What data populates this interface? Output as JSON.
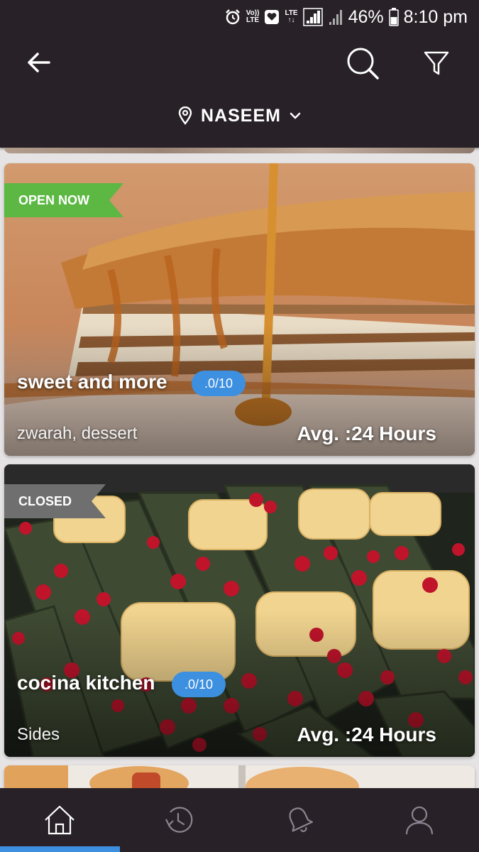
{
  "status_bar": {
    "volte_top": "Vo))",
    "volte_bottom": "LTE",
    "lte_label": "LTE",
    "battery": "46%",
    "time": "8:10 pm"
  },
  "header": {
    "location": "NASEEM"
  },
  "restaurants": [
    {
      "status": "OPEN NOW",
      "name": "sweet and more",
      "rating": ".0/10",
      "categories": "zwarah, dessert",
      "avg_time": "Avg. :24 Hours"
    },
    {
      "status": "CLOSED",
      "name": "cocina kitchen",
      "rating": ".0/10",
      "categories": "Sides",
      "avg_time": "Avg. :24 Hours"
    }
  ],
  "colors": {
    "bar_bg": "#282228",
    "accent": "#3d8fe0",
    "open_badge": "#5cb843",
    "closed_badge": "#6f6f6f"
  },
  "icons": {
    "back": "arrow-left-icon",
    "search": "search-icon",
    "filter": "filter-icon",
    "location": "location-pin-icon",
    "dropdown": "chevron-down-icon",
    "nav": [
      "home-icon",
      "history-icon",
      "notification-bell-icon",
      "profile-icon"
    ]
  }
}
